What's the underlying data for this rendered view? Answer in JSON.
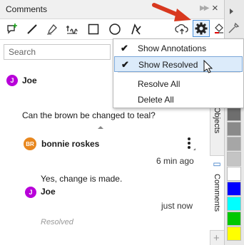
{
  "panel": {
    "title": "Comments"
  },
  "search": {
    "placeholder": "Search"
  },
  "menu": {
    "items": [
      {
        "label": "Show Annotations",
        "checked": true
      },
      {
        "label": "Show Resolved",
        "checked": true
      },
      {
        "label": "Resolve All",
        "checked": false
      },
      {
        "label": "Delete All",
        "checked": false
      }
    ]
  },
  "comments": {
    "thread_author": {
      "initial": "J",
      "name": "Joe",
      "color": "#b800d9"
    },
    "question": "Can the brown be changed to teal?",
    "reply1": {
      "initials": "BR",
      "name": "bonnie roskes",
      "color": "#e8871e",
      "time": "6 min ago"
    },
    "answer": "Yes, change is made.",
    "reply2": {
      "initial": "J",
      "name": "Joe",
      "color": "#b800d9",
      "time": "just now"
    },
    "status": "Resolved"
  },
  "side_tabs": {
    "objects": "Objects",
    "comments": "Comments"
  },
  "palette_colors": [
    "#6e6e6e",
    "#8a8a8a",
    "#a6a6a6",
    "#c4c4c4",
    "#ffffff",
    "#0000ff",
    "#00ffff",
    "#00c800",
    "#ffff00"
  ]
}
